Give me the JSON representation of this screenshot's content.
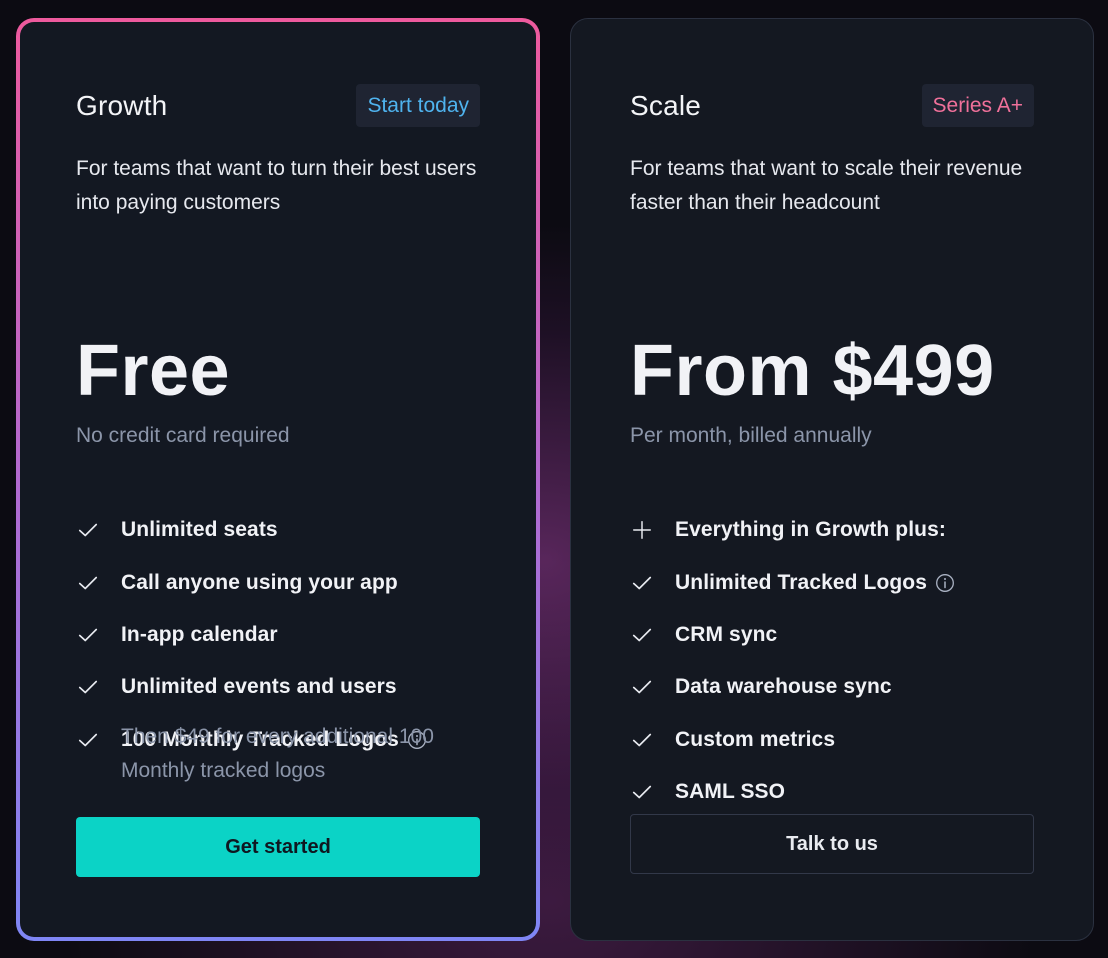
{
  "plans": [
    {
      "name": "Growth",
      "tag": "Start today",
      "description": "For teams that want to turn their best users into paying customers",
      "price": "Free",
      "price_note": "No credit card required",
      "features": [
        {
          "icon": "check-icon",
          "label": "Unlimited seats"
        },
        {
          "icon": "check-icon",
          "label": "Call anyone using your app"
        },
        {
          "icon": "check-icon",
          "label": "In-app calendar"
        },
        {
          "icon": "check-icon",
          "label": "Unlimited events and users"
        },
        {
          "icon": "check-icon",
          "label": "100 Monthly Tracked Logos",
          "info": true
        }
      ],
      "sub_note": "Then $49 for every additional 100 Monthly tracked logos",
      "cta": "Get started"
    },
    {
      "name": "Scale",
      "tag": "Series A+",
      "description": "For teams that want to scale their revenue faster than their headcount",
      "price": "From $499",
      "price_note": "Per month, billed annually",
      "features": [
        {
          "icon": "plus-icon",
          "label": "Everything in Growth plus:"
        },
        {
          "icon": "check-icon",
          "label": "Unlimited Tracked Logos",
          "info": true
        },
        {
          "icon": "check-icon",
          "label": "CRM sync"
        },
        {
          "icon": "check-icon",
          "label": "Data warehouse sync"
        },
        {
          "icon": "check-icon",
          "label": "Custom metrics"
        },
        {
          "icon": "check-icon",
          "label": "SAML SSO"
        }
      ],
      "cta": "Talk to us"
    }
  ],
  "colors": {
    "accent_teal": "#0bd3c6",
    "tag_blue": "#4fb3ee",
    "tag_pink": "#f0709a",
    "card_bg": "#141821",
    "muted_text": "#8b95a9"
  }
}
